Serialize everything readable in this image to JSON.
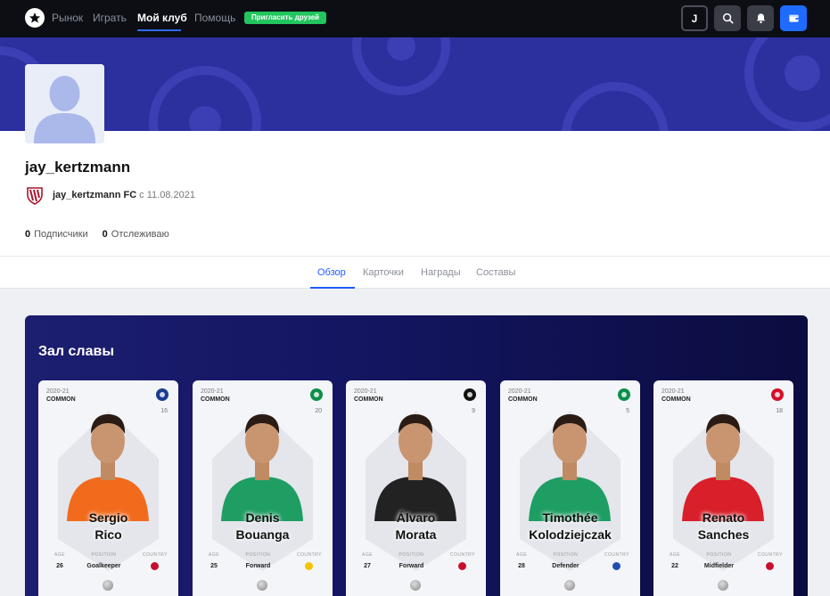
{
  "nav": {
    "items": [
      "Рынок",
      "Играть",
      "Мой клуб",
      "Помощь"
    ],
    "active": "Мой клуб",
    "invite_label": "Пригласить друзей",
    "avatar_initial": "J",
    "icons": [
      "search-icon",
      "bell-icon",
      "wallet-icon"
    ]
  },
  "profile": {
    "username": "jay_kertzmann",
    "club_name": "jay_kertzmann FC",
    "since": "с 11.08.2021",
    "followers_count": "0",
    "followers_label": "Подписчики",
    "following_count": "0",
    "following_label": "Отслеживаю"
  },
  "tabs": [
    "Обзор",
    "Карточки",
    "Награды",
    "Составы"
  ],
  "active_tab": "Обзор",
  "hall": {
    "title": "Зал славы",
    "age_label": "AGE",
    "position_label": "POSITION",
    "country_label": "COUNTRY",
    "cards": [
      {
        "season": "2020-21",
        "rarity": "COMMON",
        "number": "16",
        "first": "Sergio",
        "last": "Rico",
        "age": "26",
        "position": "Goalkeeper",
        "club_color": "#1b3d8f",
        "kit_color": "#f26b1d",
        "flag_color": "#c8102e"
      },
      {
        "season": "2020-21",
        "rarity": "COMMON",
        "number": "20",
        "first": "Denis",
        "last": "Bouanga",
        "age": "25",
        "position": "Forward",
        "club_color": "#0b8f4c",
        "kit_color": "#1f9e63",
        "flag_color": "#f4c300"
      },
      {
        "season": "2020-21",
        "rarity": "COMMON",
        "number": "9",
        "first": "Álvaro",
        "last": "Morata",
        "age": "27",
        "position": "Forward",
        "club_color": "#111111",
        "kit_color": "#222222",
        "flag_color": "#c8102e"
      },
      {
        "season": "2020-21",
        "rarity": "COMMON",
        "number": "5",
        "first": "Timothée",
        "last": "Kolodziejczak",
        "age": "28",
        "position": "Defender",
        "club_color": "#0b8f4c",
        "kit_color": "#1f9e63",
        "flag_color": "#1f4db3"
      },
      {
        "season": "2020-21",
        "rarity": "COMMON",
        "number": "18",
        "first": "Renato",
        "last": "Sanches",
        "age": "22",
        "position": "Midfielder",
        "club_color": "#d6102b",
        "kit_color": "#d81f2a",
        "flag_color": "#c8102e"
      }
    ]
  }
}
